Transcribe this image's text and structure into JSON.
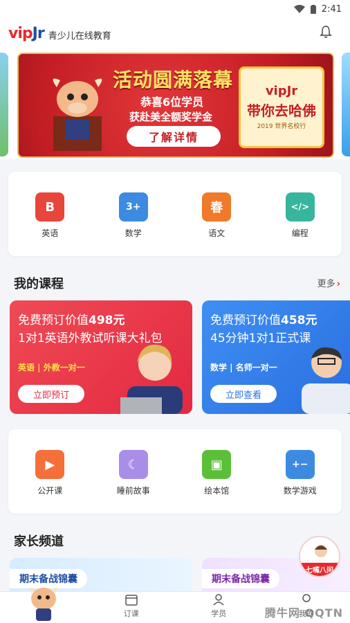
{
  "status_bar": {
    "time": "2:41"
  },
  "header": {
    "logo_main": "vip",
    "logo_accent": "Jr",
    "tagline": "青少儿在线教育"
  },
  "banner": {
    "title": "活动圆满落幕",
    "line1": "恭喜6位学员",
    "line2": "获赴美全额奖学金",
    "cta": "了解详情",
    "badge_brand": "vipJr",
    "badge_slogan": "带你去哈佛",
    "badge_small": "2019 世界名校行"
  },
  "subjects": [
    {
      "label": "英语",
      "icon": "book-icon",
      "color": "#e8453c",
      "glyph": "B"
    },
    {
      "label": "数学",
      "icon": "math-icon",
      "color": "#3d8be0",
      "glyph": "3+"
    },
    {
      "label": "语文",
      "icon": "chinese-icon",
      "color": "#f07a2a",
      "glyph": "春"
    },
    {
      "label": "编程",
      "icon": "code-icon",
      "color": "#37b59d",
      "glyph": "</>"
    }
  ],
  "my_courses": {
    "title": "我的课程",
    "more": "更多",
    "cards": [
      {
        "line1_prefix": "免费预订价值",
        "line1_price": "498元",
        "line2": "1对1英语外教试听课大礼包",
        "tag": "英语 | 外教一对一",
        "button": "立即预订"
      },
      {
        "line1_prefix": "免费预订价值",
        "line1_price": "458元",
        "line2": "45分钟1对1正式课",
        "tag": "数学 | 名师一对一",
        "button": "立即查看"
      }
    ]
  },
  "features": [
    {
      "label": "公开课",
      "icon": "video-icon",
      "color": "#f46f3a"
    },
    {
      "label": "睡前故事",
      "icon": "moon-icon",
      "color": "#a98ee8"
    },
    {
      "label": "绘本馆",
      "icon": "picture-book-icon",
      "color": "#5cbf3a"
    },
    {
      "label": "数学游戏",
      "icon": "math-game-icon",
      "color": "#3d8be0"
    }
  ],
  "parent_channel": {
    "title": "家长频道",
    "cards": [
      {
        "label": "期末备战锦囊"
      },
      {
        "label": "期末备战锦囊"
      }
    ]
  },
  "help_float": {
    "label": "七嘴八问"
  },
  "tabbar": [
    {
      "label": "",
      "icon": "mascot-home-icon"
    },
    {
      "label": "订课",
      "icon": "calendar-icon"
    },
    {
      "label": "学员",
      "icon": "student-icon"
    },
    {
      "label": "我的",
      "icon": "profile-icon"
    }
  ],
  "watermark": "腾牛网 QQTN"
}
